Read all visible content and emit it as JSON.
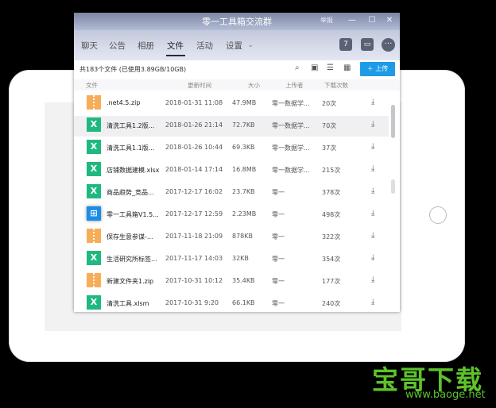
{
  "window": {
    "title": "零一工具箱交流群",
    "report_label": "举报",
    "btn_minimize": "—",
    "btn_maximize": "☐",
    "btn_close": "✕"
  },
  "tabs": [
    {
      "label": "聊天"
    },
    {
      "label": "公告"
    },
    {
      "label": "相册"
    },
    {
      "label": "文件",
      "active": true
    },
    {
      "label": "活动"
    },
    {
      "label": "设置"
    }
  ],
  "header_icons": {
    "calendar": "calendar-icon",
    "folder": "folder-icon",
    "more": "more-icon"
  },
  "toolbar": {
    "file_count": "共183个文件 (已使用3.89GB/10GB)",
    "upload_label": "上传",
    "icons": [
      "search-icon",
      "archive-icon",
      "list-view-icon",
      "grid-view-icon"
    ]
  },
  "columns": {
    "file": "文件",
    "time": "更新时间",
    "size": "大小",
    "uploader": "上传者",
    "downloads": "下载次数"
  },
  "files": [
    {
      "type": "zip",
      "name": ".net4.5.zip",
      "time": "2018-01-31 11:08",
      "size": "47.9MB",
      "uploader": "零一数据学...",
      "downloads": "20次"
    },
    {
      "type": "excel",
      "name": "清洗工具1.2版...",
      "time": "2018-01-26 21:14",
      "size": "72.7KB",
      "uploader": "零一数据学...",
      "downloads": "70次"
    },
    {
      "type": "excel",
      "name": "清洗工具1.1版...",
      "time": "2018-01-26 10:44",
      "size": "69.3KB",
      "uploader": "零一数据学...",
      "downloads": "37次"
    },
    {
      "type": "excel",
      "name": "店铺数据建模.xlsx",
      "time": "2018-01-14 17:14",
      "size": "16.8MB",
      "uploader": "零一数据学...",
      "downloads": "215次"
    },
    {
      "type": "excel",
      "name": "商品趋势_竞品...",
      "time": "2017-12-17 16:02",
      "size": "23.7KB",
      "uploader": "零一",
      "downloads": "378次"
    },
    {
      "type": "windows",
      "name": "零一工具箱V1.5...",
      "time": "2017-12-17 12:59",
      "size": "2.23MB",
      "uploader": "零一",
      "downloads": "498次"
    },
    {
      "type": "zip",
      "name": "保存生意参谋-...",
      "time": "2017-11-18 21:09",
      "size": "878KB",
      "uploader": "零一",
      "downloads": "322次"
    },
    {
      "type": "excel",
      "name": "生活研究所标签...",
      "time": "2017-11-17 14:03",
      "size": "32KB",
      "uploader": "零一",
      "downloads": "354次"
    },
    {
      "type": "zip",
      "name": "新建文件夹1.zip",
      "time": "2017-10-31 10:12",
      "size": "35.4KB",
      "uploader": "零一",
      "downloads": "177次"
    },
    {
      "type": "excel",
      "name": "清洗工具.xlsm",
      "time": "2017-10-31 9:20",
      "size": "66.1KB",
      "uploader": "零一",
      "downloads": "240次"
    }
  ],
  "watermark": {
    "logo": "宝哥下载",
    "url": "www.baoge.net"
  },
  "colors": {
    "accent": "#1e9be6",
    "excel": "#1fb980",
    "zip": "#f7ad57",
    "windows": "#1a8de8",
    "logo": "#5ec22a"
  }
}
